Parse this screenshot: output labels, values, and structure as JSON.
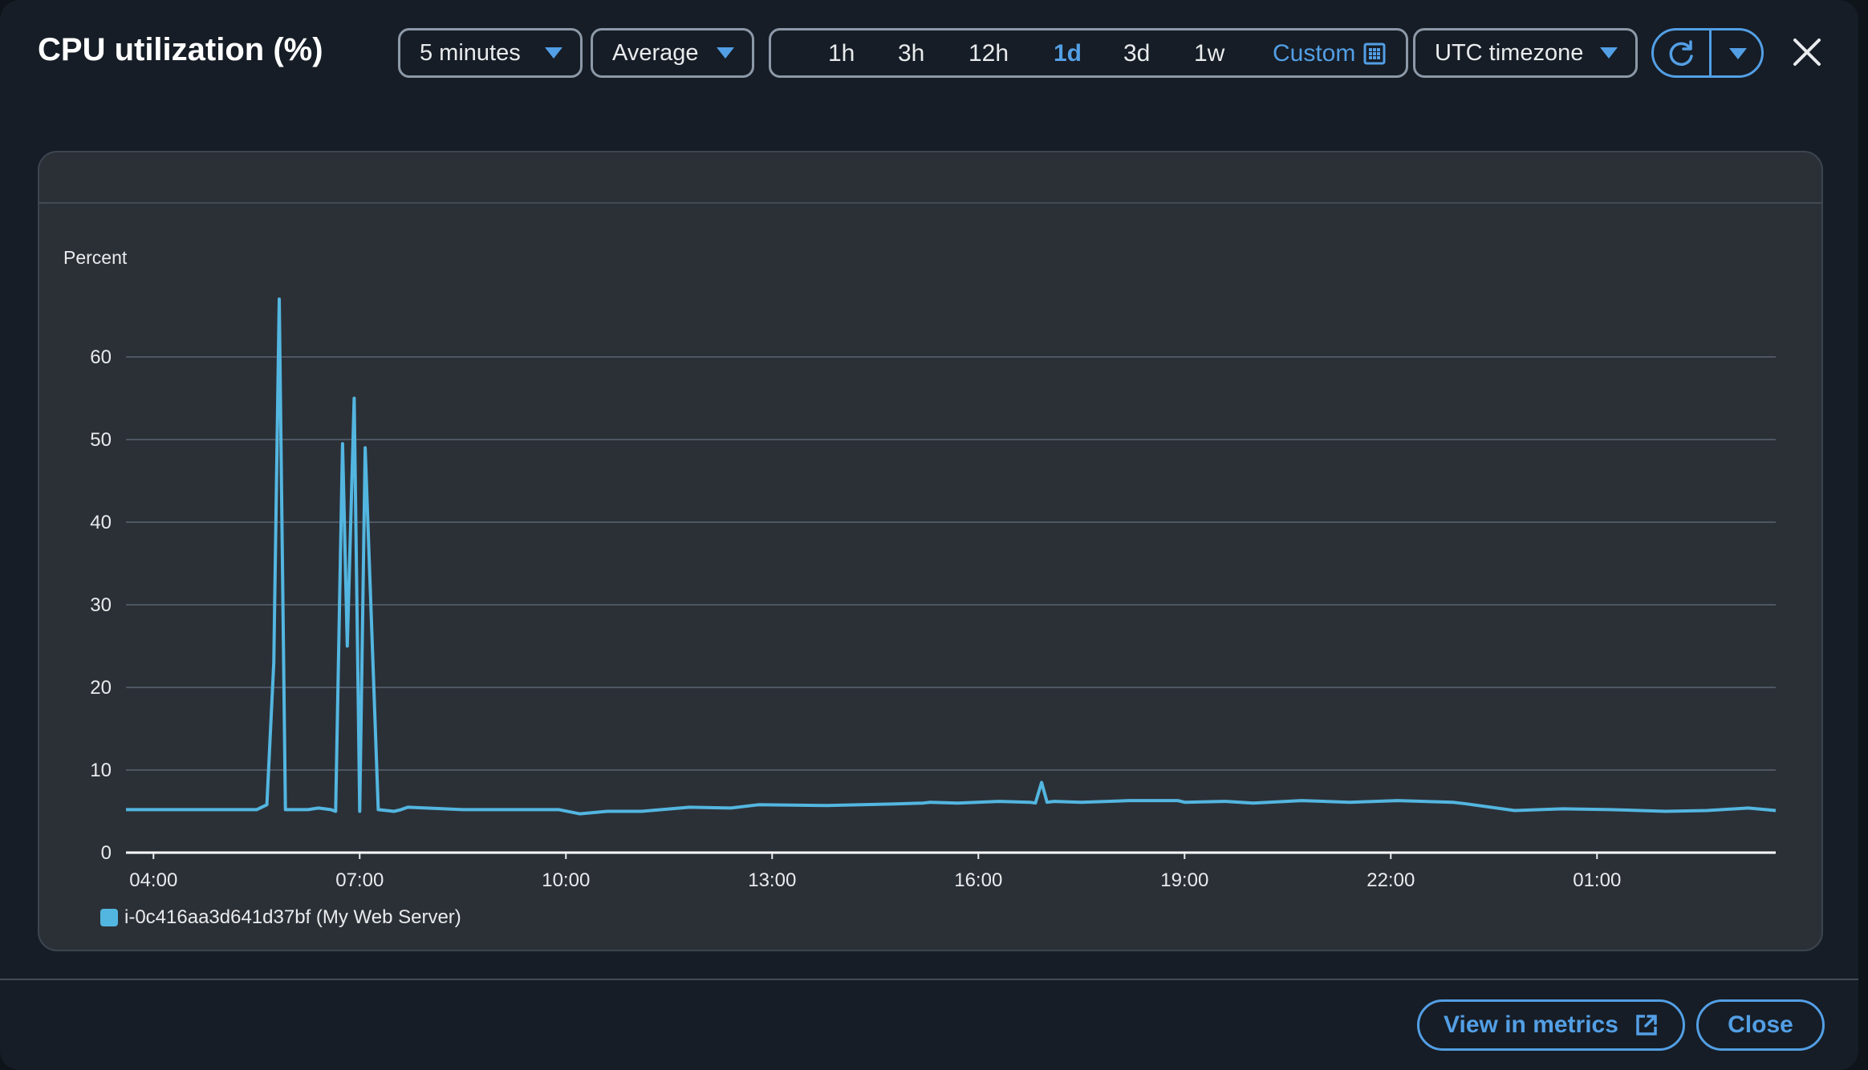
{
  "header": {
    "title": "CPU utilization (%)",
    "period": "5 minutes",
    "statistic": "Average",
    "ranges": [
      "1h",
      "3h",
      "12h",
      "1d",
      "3d",
      "1w"
    ],
    "active_range": "1d",
    "custom_label": "Custom",
    "timezone": "UTC timezone"
  },
  "footer": {
    "view_in_metrics": "View in metrics",
    "close": "Close"
  },
  "colors": {
    "accent": "#539fe5",
    "series": "#53b6e0",
    "background": "#161d26",
    "panel": "#2b3037"
  },
  "chart_data": {
    "type": "line",
    "ylabel": "Percent",
    "ylim": [
      0,
      70
    ],
    "yticks": [
      0,
      10,
      20,
      30,
      40,
      50,
      60
    ],
    "xticks": [
      "04:00",
      "07:00",
      "10:00",
      "13:00",
      "16:00",
      "19:00",
      "22:00",
      "01:00"
    ],
    "xlim_hours": [
      3.6,
      27.6
    ],
    "series": [
      {
        "name": "i-0c416aa3d641d37bf (My Web Server)",
        "x": [
          3.6,
          4.5,
          5.5,
          5.65,
          5.75,
          5.83,
          5.92,
          6.0,
          6.25,
          6.4,
          6.58,
          6.65,
          6.75,
          6.82,
          6.92,
          7.0,
          7.08,
          7.27,
          7.5,
          7.6,
          7.7,
          8.5,
          9.5,
          9.9,
          10.2,
          10.6,
          11.1,
          11.8,
          12.4,
          12.8,
          13.8,
          14.8,
          15.2,
          15.3,
          15.7,
          16.3,
          16.75,
          16.83,
          16.92,
          17.0,
          17.1,
          17.5,
          18.2,
          18.9,
          19.0,
          19.6,
          20.0,
          20.7,
          21.4,
          22.1,
          22.9,
          23.1,
          23.8,
          24.5,
          25.2,
          26.0,
          26.6,
          27.2,
          27.6
        ],
        "y": [
          5.2,
          5.2,
          5.2,
          5.8,
          23,
          67,
          5.2,
          5.2,
          5.2,
          5.4,
          5.2,
          5.0,
          49.5,
          25,
          55,
          5.0,
          49,
          5.2,
          5.0,
          5.2,
          5.5,
          5.2,
          5.2,
          5.2,
          4.7,
          5.0,
          5.0,
          5.5,
          5.4,
          5.8,
          5.7,
          5.9,
          6.0,
          6.1,
          6.0,
          6.2,
          6.1,
          6.0,
          8.5,
          6.1,
          6.2,
          6.1,
          6.3,
          6.3,
          6.1,
          6.2,
          6.0,
          6.3,
          6.1,
          6.3,
          6.1,
          5.9,
          5.1,
          5.3,
          5.2,
          5.0,
          5.1,
          5.4,
          5.1
        ]
      }
    ]
  }
}
